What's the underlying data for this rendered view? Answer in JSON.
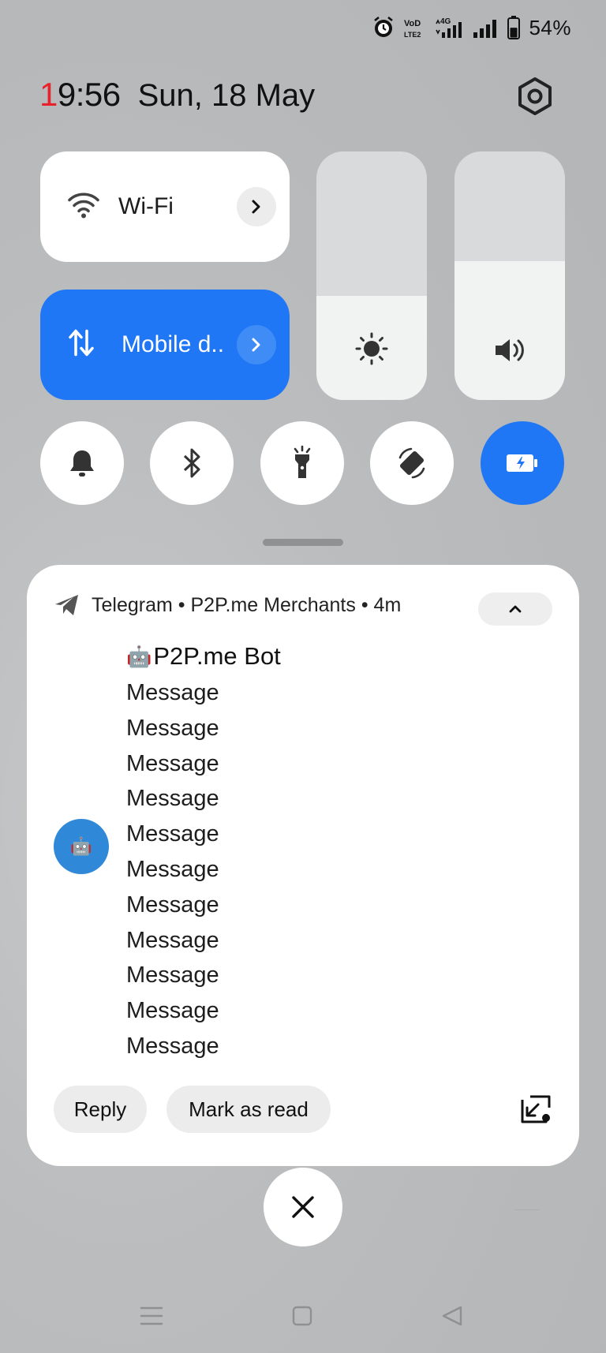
{
  "status_bar": {
    "icons": [
      "alarm-icon",
      "volte-icon",
      "4g-signal-icon",
      "signal-icon",
      "battery-icon"
    ],
    "volte_text": "VoLTE2",
    "network_text": "4G",
    "battery_percent": "54%",
    "battery_level": 0.54
  },
  "header": {
    "time_first_digit": "1",
    "time_rest": "9:56",
    "date": "Sun, 18 May"
  },
  "tiles": {
    "wifi": {
      "label": "Wi-Fi",
      "active": false
    },
    "mobile_data": {
      "label": "Mobile d..",
      "active": true
    }
  },
  "sliders": {
    "brightness_level": 0.42,
    "volume_level": 0.56
  },
  "toggles": [
    {
      "name": "sound",
      "icon": "bell-icon",
      "active": false
    },
    {
      "name": "bluetooth",
      "icon": "bluetooth-icon",
      "active": false
    },
    {
      "name": "flashlight",
      "icon": "flashlight-icon",
      "active": false
    },
    {
      "name": "auto-rotate",
      "icon": "rotate-icon",
      "active": false
    },
    {
      "name": "battery-saver",
      "icon": "battery-charging-icon",
      "active": true
    }
  ],
  "notification": {
    "app": "Telegram",
    "group": "P2P.me Merchants",
    "time": "4m",
    "separator": "•",
    "sender_emoji": "🤖",
    "sender": "P2P.me Bot",
    "avatar_emoji": "🤖",
    "messages": [
      "Message",
      "Message",
      "Message",
      "Message",
      "Message",
      "Message",
      "Message",
      "Message",
      "Message",
      "Message",
      "Message"
    ],
    "actions": {
      "reply": "Reply",
      "mark_read": "Mark as read"
    }
  },
  "colors": {
    "accent": "#1f77f5",
    "clock_red": "#e8222c",
    "avatar": "#2f88d8"
  }
}
